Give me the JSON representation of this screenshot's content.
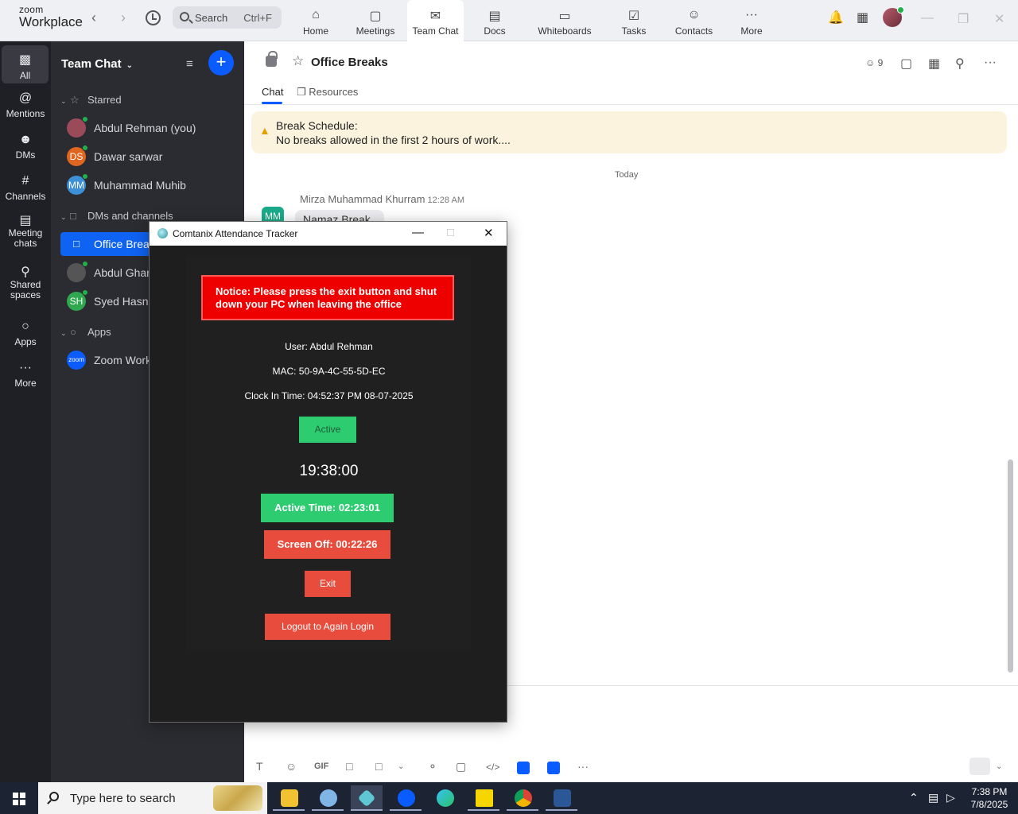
{
  "app": {
    "logo_line1": "zoom",
    "logo_line2": "Workplace"
  },
  "topbar": {
    "search_placeholder": "Search",
    "search_shortcut": "Ctrl+F",
    "tabs": [
      {
        "label": "Home",
        "icon": "home-icon"
      },
      {
        "label": "Meetings",
        "icon": "video-icon"
      },
      {
        "label": "Team Chat",
        "icon": "chat-icon"
      },
      {
        "label": "Docs",
        "icon": "doc-icon"
      },
      {
        "label": "Whiteboards",
        "icon": "whiteboard-icon"
      },
      {
        "label": "Tasks",
        "icon": "tasks-icon"
      },
      {
        "label": "Contacts",
        "icon": "contacts-icon"
      },
      {
        "label": "More",
        "icon": "more-icon"
      }
    ],
    "active_tab": "Team Chat"
  },
  "rail": {
    "items": [
      {
        "label": "All"
      },
      {
        "label": "Mentions"
      },
      {
        "label": "DMs"
      },
      {
        "label": "Channels"
      },
      {
        "label": "Meeting chats"
      },
      {
        "label": "Shared spaces"
      },
      {
        "label": "Apps"
      },
      {
        "label": "More"
      }
    ]
  },
  "sidebar": {
    "title": "Team Chat",
    "sections": {
      "starred": "Starred",
      "dms_channels": "DMs and channels",
      "apps": "Apps"
    },
    "starred": [
      {
        "name": "Abdul Rehman (you)",
        "initials": "",
        "color": "#9b4a5a"
      },
      {
        "name": "Dawar sarwar",
        "initials": "DS",
        "color": "#e0661f"
      },
      {
        "name": "Muhammad Muhib",
        "initials": "MM",
        "color": "#3d8fd6"
      }
    ],
    "channels": [
      {
        "name": "Office Break",
        "active": true
      },
      {
        "name": "Abdul Ghan",
        "initials": "",
        "color": "#555"
      },
      {
        "name": "Syed Hasna",
        "initials": "SH",
        "color": "#2fa84f"
      }
    ],
    "apps": [
      {
        "name": "Zoom Work",
        "initials": "zoom",
        "color": "#0b5cff"
      }
    ]
  },
  "chat": {
    "title": "Office Breaks",
    "members": "9",
    "tabs": [
      "Chat",
      "Resources"
    ],
    "pinned_title": "Break Schedule:",
    "pinned_text": "No breaks allowed in the first 2 hours of work....",
    "day_divider": "Today",
    "message_sender": "Mirza Muhammad Khurram",
    "message_time": "12:28 AM",
    "message_initials": "MM",
    "message_text": "Namaz Break"
  },
  "tracker": {
    "window_title": "Comtanix Attendance Tracker",
    "notice": "Notice: Please press the exit button and shut down your PC when leaving the office",
    "user": "User: Abdul Rehman",
    "mac": "MAC: 50-9A-4C-55-5D-EC",
    "clock_in": "Clock In Time: 04:52:37 PM 08-07-2025",
    "status": "Active",
    "clock": "19:38:00",
    "active_time": "Active Time: 02:23:01",
    "screen_off": "Screen Off: 00:22:26",
    "exit": "Exit",
    "logout": "Logout to Again Login"
  },
  "taskbar": {
    "search_placeholder": "Type here to search",
    "time": "7:38 PM",
    "date": "7/8/2025"
  }
}
